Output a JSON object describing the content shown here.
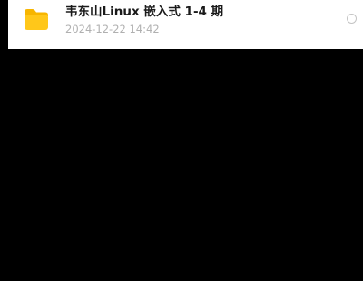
{
  "file_list": {
    "items": [
      {
        "icon": "folder-icon",
        "name": "韦东山Linux 嵌入式 1-4 期",
        "modified": "2024-12-22 14:42",
        "selected": false
      }
    ]
  },
  "colors": {
    "background": "#000000",
    "row_background": "#ffffff",
    "folder_body": "#ffc71a",
    "folder_tab": "#f7b500",
    "title_text": "#1a1a1a",
    "meta_text": "#b0b0b0",
    "radio_border": "#c4c4c4"
  }
}
